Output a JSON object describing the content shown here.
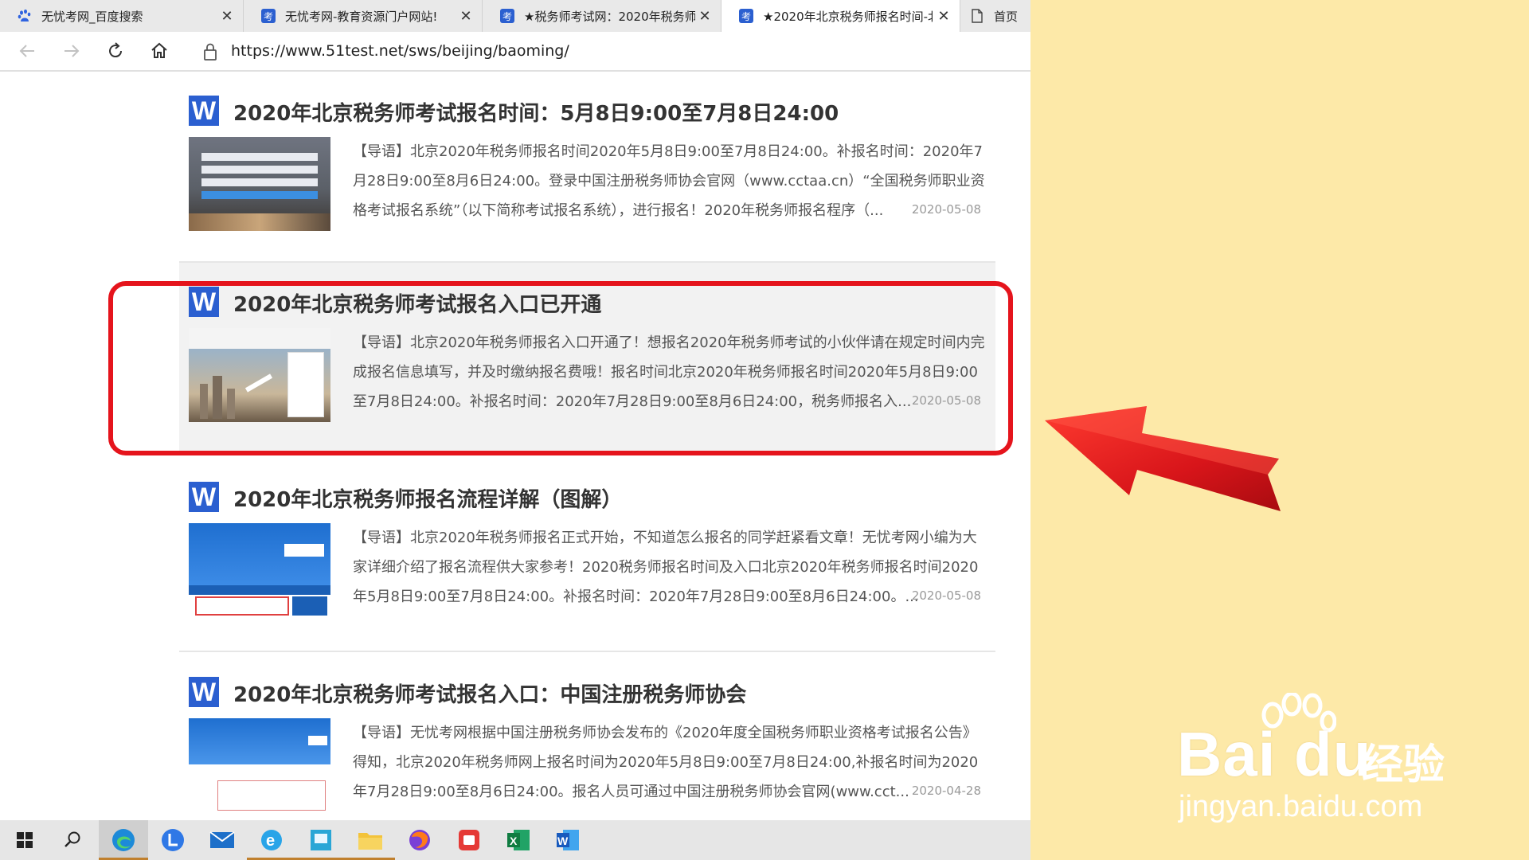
{
  "browser": {
    "tabs": [
      {
        "title": "无忧考网_百度搜索",
        "icon": "baidu-paw-icon",
        "active": false,
        "closable": true
      },
      {
        "title": "无忧考网-教育资源门户网站!",
        "icon": "kao-site-icon",
        "active": false,
        "closable": true
      },
      {
        "title": "★税务师考试网：2020年税务师",
        "icon": "kao-site-icon",
        "active": false,
        "closable": true
      },
      {
        "title": "★2020年北京税务师报名时间-北",
        "icon": "kao-site-icon",
        "active": true,
        "closable": true
      },
      {
        "title": "首页",
        "icon": "page-icon",
        "active": false,
        "closable": false
      }
    ],
    "url": "https://www.51test.net/sws/beijing/baoming/"
  },
  "articles": [
    {
      "title": "2020年北京税务师考试报名时间：5月8日9:00至7月8日24:00",
      "excerpt": "【导语】北京2020年税务师报名时间2020年5月8日9:00至7月8日24:00。补报名时间：2020年7月28日9:00至8月6日24:00。登录中国注册税务师协会官网（www.cctaa.cn）“全国税务师职业资格考试报名系统”（以下简称考试报名系统），进行报名！2020年税务师报名程序（...",
      "date": "2020-05-08",
      "highlighted": false
    },
    {
      "title": "2020年北京税务师考试报名入口已开通",
      "excerpt": "【导语】北京2020年税务师报名入口开通了！想报名2020年税务师考试的小伙伴请在规定时间内完成报名信息填写，并及时缴纳报名费哦！报名时间北京2020年税务师报名时间2020年5月8日9:00至7月8日24:00。补报名时间：2020年7月28日9:00至8月6日24:00，税务师报名入...",
      "date": "2020-05-08",
      "highlighted": true
    },
    {
      "title": "2020年北京税务师报名流程详解（图解）",
      "excerpt": "【导语】北京2020年税务师报名正式开始，不知道怎么报名的同学赶紧看文章！无忧考网小编为大家详细介绍了报名流程供大家参考！2020税务师报名时间及入口北京2020年税务师报名时间2020年5月8日9:00至7月8日24:00。补报名时间：2020年7月28日9:00至8月6日24:00。...",
      "date": "2020-05-08",
      "highlighted": false
    },
    {
      "title": "2020年北京税务师考试报名入口：中国注册税务师协会",
      "excerpt": "【导语】无忧考网根据中国注册税务师协会发布的《2020年度全国税务师职业资格考试报名公告》得知，北京2020年税务师网上报名时间为2020年5月8日9:00至7月8日24:00,补报名时间为2020年7月28日9:00至8月6日24:00。报名人员可通过中国注册税务师协会官网(www.cct...",
      "date": "2020-04-28",
      "highlighted": false
    }
  ],
  "taskbar": {
    "items": [
      "windows-start-icon",
      "search-icon",
      "edge-icon",
      "lark-icon",
      "mail-icon",
      "ie-icon",
      "photos-icon",
      "file-explorer-icon",
      "firefox-icon",
      "screen-recorder-icon",
      "excel-icon",
      "word-icon"
    ]
  },
  "watermark": {
    "brand": "Bai du",
    "jingyan": "经验",
    "url": "jingyan.baidu.com"
  },
  "colors": {
    "highlight": "#e5141c",
    "panel": "#fde9a8",
    "arrow": "#d8151a",
    "word_blue": "#2b5fd0"
  }
}
